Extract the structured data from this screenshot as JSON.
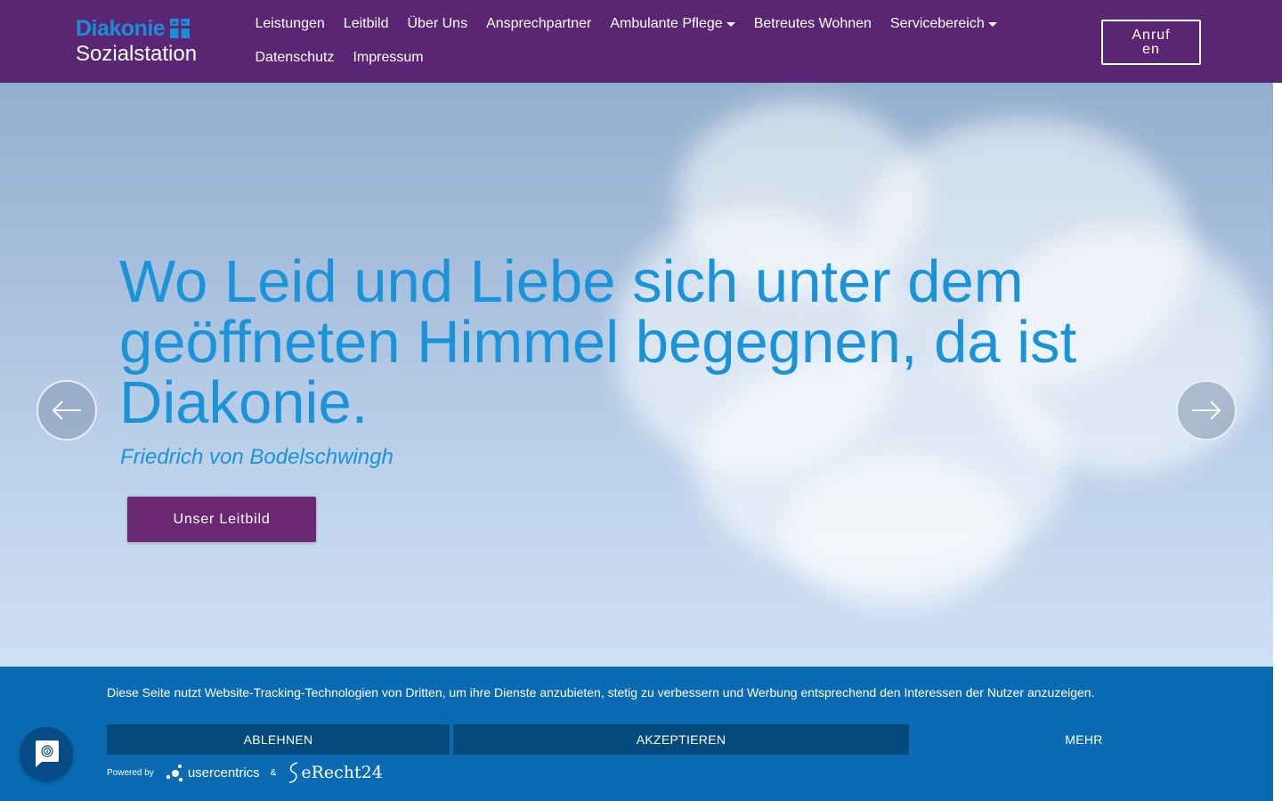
{
  "header": {
    "logo_word": "Diakonie",
    "logo_sub": "Sozialstation",
    "nav_row1": [
      {
        "label": "Leistungen"
      },
      {
        "label": "Leitbild"
      },
      {
        "label": "Über Uns"
      },
      {
        "label": "Ansprechpartner"
      },
      {
        "label": "Ambulante Pflege",
        "dropdown": true
      },
      {
        "label": "Betreutes Wohnen"
      },
      {
        "label": "Servicebereich",
        "dropdown": true
      }
    ],
    "nav_row2": [
      {
        "label": "Datenschutz"
      },
      {
        "label": "Impressum"
      }
    ],
    "call_label": "Anrufen"
  },
  "hero": {
    "quote": "Wo Leid und Liebe sich unter dem geöffneten Himmel begegnen, da ist Diakonie.",
    "author": "Friedrich von Bodelschwingh",
    "button_label": "Unser Leitbild"
  },
  "cookie": {
    "text": "Diese Seite nutzt Website-Tracking-Technologien von Dritten, um ihre Dienste anzubieten, stetig zu verbessern und Werbung entsprechend den Interessen der Nutzer anzuzeigen.",
    "decline_label": "ABLEHNEN",
    "accept_label": "AKZEPTIEREN",
    "more_label": "MEHR",
    "powered_by": "Powered by",
    "usercentrics": "usercentrics",
    "amp": "&",
    "erecht": "eRecht24"
  },
  "colors": {
    "header_bg": "#5a2673",
    "brand_blue": "#1a93d9",
    "button_purple": "#6b2674",
    "cookie_bg": "#0a6ab2",
    "cookie_btn": "#044a7d"
  }
}
